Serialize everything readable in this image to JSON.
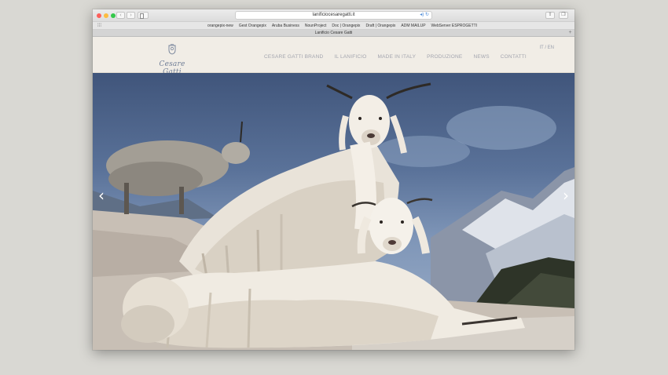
{
  "browser": {
    "url": "lanificiocesaregatti.it",
    "tab_title": "Lanificio Cesare Gatti",
    "bookmarks": [
      "orangepix-new",
      "Gest Orangepix",
      "Aruba Business",
      "NounProject",
      "Doc | Orangepix",
      "Draft | Orangepix",
      "ADM MAILUP",
      "WebServer ESPROGETTI"
    ]
  },
  "site": {
    "logo_text": "Cesare Gatti",
    "nav": [
      "CESARE GATTI BRAND",
      "IL LANIFICIO",
      "MADE IN ITALY",
      "PRODUZIONE",
      "NEWS",
      "CONTATTI"
    ],
    "lang": "IT / EN"
  },
  "hero": {
    "prev_icon": "chevron-left-icon",
    "next_icon": "chevron-right-icon"
  },
  "colors": {
    "header_bg": "#f1ede6",
    "nav_text": "#a3a5ae",
    "logo": "#6f7d96"
  }
}
